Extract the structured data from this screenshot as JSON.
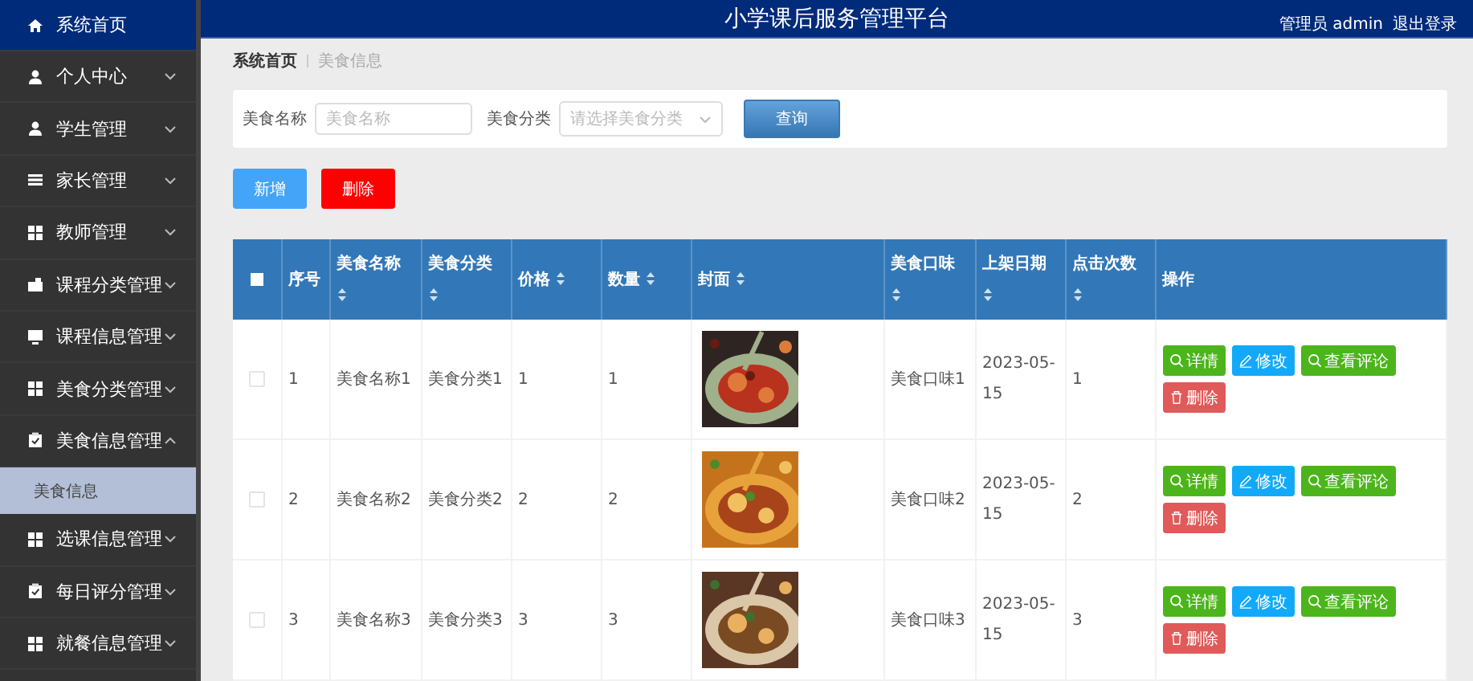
{
  "header": {
    "title": "小学课后服务管理平台",
    "user": "管理员 admin",
    "logout": "退出登录"
  },
  "sidebar": {
    "items": [
      {
        "label": "系统首页",
        "kind": "home"
      },
      {
        "label": "个人中心",
        "kind": "menu",
        "expanded": false
      },
      {
        "label": "学生管理",
        "kind": "menu",
        "expanded": false
      },
      {
        "label": "家长管理",
        "kind": "menu",
        "expanded": false
      },
      {
        "label": "教师管理",
        "kind": "menu",
        "expanded": false
      },
      {
        "label": "课程分类管理",
        "kind": "menu",
        "expanded": false
      },
      {
        "label": "课程信息管理",
        "kind": "menu",
        "expanded": false
      },
      {
        "label": "美食分类管理",
        "kind": "menu",
        "expanded": false
      },
      {
        "label": "美食信息管理",
        "kind": "menu",
        "expanded": true,
        "children": [
          {
            "label": "美食信息",
            "selected": true
          }
        ]
      },
      {
        "label": "选课信息管理",
        "kind": "menu",
        "expanded": false
      },
      {
        "label": "每日评分管理",
        "kind": "menu",
        "expanded": false
      },
      {
        "label": "就餐信息管理",
        "kind": "menu",
        "expanded": false
      }
    ]
  },
  "breadcrumb": [
    "系统首页",
    "美食信息"
  ],
  "search": {
    "fields": [
      {
        "label": "美食名称",
        "placeholder": "美食名称",
        "kind": "input"
      },
      {
        "label": "美食分类",
        "placeholder": "请选择美食分类",
        "kind": "select"
      }
    ],
    "button": "查询"
  },
  "actions": [
    {
      "label": "新增",
      "kind": "add"
    },
    {
      "label": "删除",
      "kind": "delete"
    }
  ],
  "table": {
    "select_all": {
      "checked": false
    },
    "columns": [
      {
        "label": "序号",
        "sortable": false
      },
      {
        "label": "美食名称",
        "sortable": true
      },
      {
        "label": "美食分类",
        "sortable": true
      },
      {
        "label": "价格",
        "sortable": true
      },
      {
        "label": "数量",
        "sortable": true
      },
      {
        "label": "封面",
        "sortable": true
      },
      {
        "label": "美食口味",
        "sortable": true
      },
      {
        "label": "上架日期",
        "sortable": true
      },
      {
        "label": "点击次数",
        "sortable": true
      },
      {
        "label": "操作",
        "sortable": false
      }
    ],
    "rows": [
      {
        "checked": false,
        "cells": [
          "1",
          "美食名称1",
          "美食分类1",
          "1",
          "1",
          {
            "kind": "picture"
          },
          "美食口味1",
          "2023-05-15",
          "1"
        ],
        "actions": [
          {
            "label": "详情",
            "kind": "detail"
          },
          {
            "label": "修改",
            "kind": "edit"
          },
          {
            "label": "查看评论",
            "kind": "comments"
          },
          {
            "label": "删除",
            "kind": "delete"
          }
        ]
      },
      {
        "checked": false,
        "cells": [
          "2",
          "美食名称2",
          "美食分类2",
          "2",
          "2",
          {
            "kind": "picture"
          },
          "美食口味2",
          "2023-05-15",
          "2"
        ],
        "actions": [
          {
            "label": "详情",
            "kind": "detail"
          },
          {
            "label": "修改",
            "kind": "edit"
          },
          {
            "label": "查看评论",
            "kind": "comments"
          },
          {
            "label": "删除",
            "kind": "delete"
          }
        ]
      },
      {
        "checked": false,
        "cells": [
          "3",
          "美食名称3",
          "美食分类3",
          "3",
          "3",
          {
            "kind": "picture"
          },
          "美食口味3",
          "2023-05-15",
          "3"
        ],
        "actions": [
          {
            "label": "详情",
            "kind": "detail"
          },
          {
            "label": "修改",
            "kind": "edit"
          },
          {
            "label": "查看评论",
            "kind": "comments"
          },
          {
            "label": "删除",
            "kind": "delete"
          }
        ]
      }
    ]
  }
}
